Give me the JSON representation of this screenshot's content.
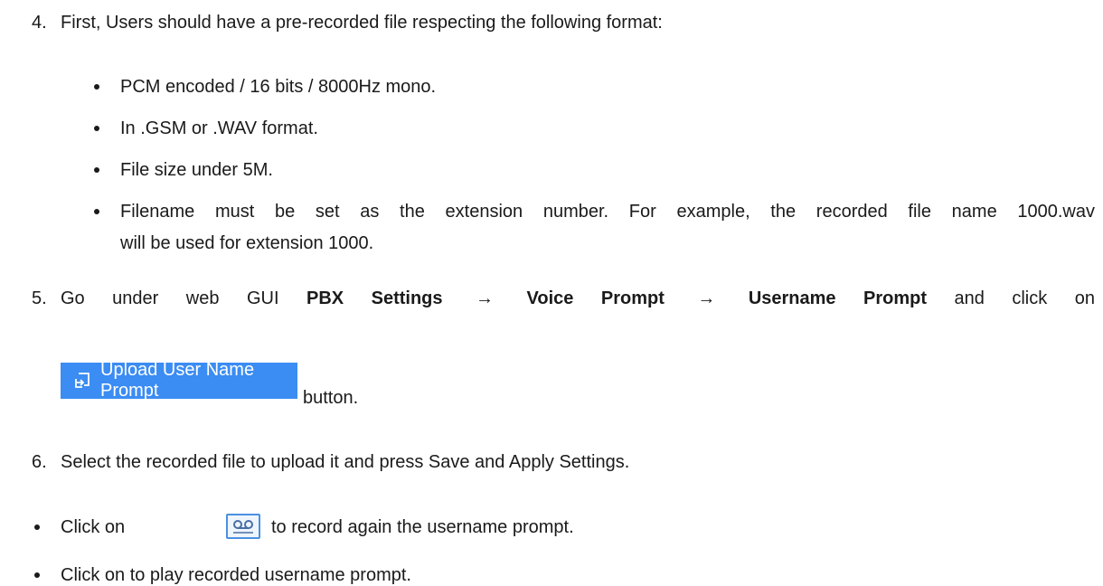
{
  "step4": {
    "number": "4.",
    "text": "First, Users should have a pre-recorded file respecting the following format:"
  },
  "bullets": [
    "PCM encoded / 16 bits / 8000Hz mono.",
    "In .GSM or .WAV format.",
    "File size under 5M."
  ],
  "bullet4": {
    "line1": "Filename must be set as the extension number. For example, the recorded file name 1000.wav",
    "line2": "will be used for extension 1000."
  },
  "step5": {
    "number": "5.",
    "intro": "Go under web GUI",
    "menu1": "PBX Settings",
    "arrow": "→",
    "menu2": "Voice Prompt",
    "menu3": "Username Prompt",
    "outro": "and click on",
    "button_label": "Upload User Name Prompt",
    "after_button": "button."
  },
  "step6": {
    "number": "6.",
    "text": "Select the recorded file to upload it and press Save and Apply Settings."
  },
  "click_record": {
    "before": "Click on",
    "after": "to record again the username prompt.",
    "icon": "cassette-record-icon"
  },
  "click_play": {
    "text": "Click on to play recorded username prompt."
  },
  "colors": {
    "button_bg": "#3b8cf3",
    "button_text": "#ffffff",
    "icon_border": "#4a90e2"
  }
}
